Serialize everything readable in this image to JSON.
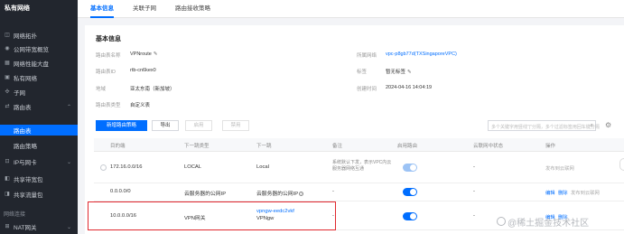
{
  "sidebar": {
    "title": "私有网络",
    "items": [
      {
        "label": "网络拓扑",
        "icon": "topology-icon"
      },
      {
        "label": "公网带宽概览",
        "icon": "bandwidth-icon"
      },
      {
        "label": "网络性能大盘",
        "icon": "dashboard-icon"
      },
      {
        "label": "私有网络",
        "icon": "vpc-icon"
      },
      {
        "label": "子网",
        "icon": "subnet-icon"
      },
      {
        "label": "路由表",
        "icon": "route-table-icon"
      },
      {
        "label": "路由表"
      },
      {
        "label": "路由策略"
      },
      {
        "label": "IP与网卡",
        "icon": "ip-icon"
      },
      {
        "label": "共享带宽包",
        "icon": "share-bandwidth-icon"
      },
      {
        "label": "共享流量包",
        "icon": "share-traffic-icon"
      },
      {
        "label": "NAT网关",
        "icon": "nat-icon"
      }
    ],
    "group_label": "网络连接"
  },
  "tabs": [
    "基本信息",
    "关联子网",
    "路由接收策略"
  ],
  "basic_info": {
    "title": "基本信息",
    "left": [
      {
        "label": "路由表名称",
        "value": "VPNroute"
      },
      {
        "label": "路由表ID",
        "value": "rtb-cn6kex0"
      },
      {
        "label": "地域",
        "value": "亚太东南（新加坡）"
      },
      {
        "label": "路由表类型",
        "value": "自定义表"
      }
    ],
    "right": [
      {
        "label": "所属网络",
        "value": "vpc-p8gb77d(TXSingaporeVPC)"
      },
      {
        "label": "标签",
        "value": "暂无标签"
      },
      {
        "label": "创建时间",
        "value": "2024-04-16 14:04:19"
      }
    ]
  },
  "toolbar": {
    "new_route": "新增路由策略",
    "export": "导出",
    "enable": "启用",
    "disable": "禁用",
    "search_placeholder": "多个关键字用竖线\"|\"分隔，多个过滤标签用回车键分隔"
  },
  "table": {
    "headers": [
      "目的端",
      "下一跳类型",
      "下一跳",
      "备注",
      "启用路由",
      "云联网中状态",
      "操作"
    ],
    "rows": [
      {
        "dest": "172.16.0.0/16",
        "type": "LOCAL",
        "next_hop": "Local",
        "note": "系统默认下发，表示VPC内云服务器网络互通",
        "note2": "",
        "enabled": true,
        "ccn": "-",
        "actions": [
          "发布到云联网"
        ]
      },
      {
        "dest": "0.0.0.0/0",
        "type": "云服务器的公网IP",
        "next_hop": "云服务器的公网IP",
        "note": "-",
        "enabled": true,
        "ccn": "-",
        "actions": [
          "编辑",
          "删除",
          "发布到云联网"
        ]
      },
      {
        "dest": "10.0.0.0/16",
        "type": "VPN网关",
        "next_hop": "vpngw-eedc2vkf",
        "next_hop_sub": "VPNgw",
        "note": "-",
        "enabled": true,
        "ccn": "-",
        "actions": [
          "编辑",
          "删除"
        ]
      }
    ]
  },
  "watermark": "@稀土掘金技术社区",
  "colors": {
    "accent": "#006eff",
    "highlight": "#e0282e",
    "sidebar": "#22262e"
  }
}
